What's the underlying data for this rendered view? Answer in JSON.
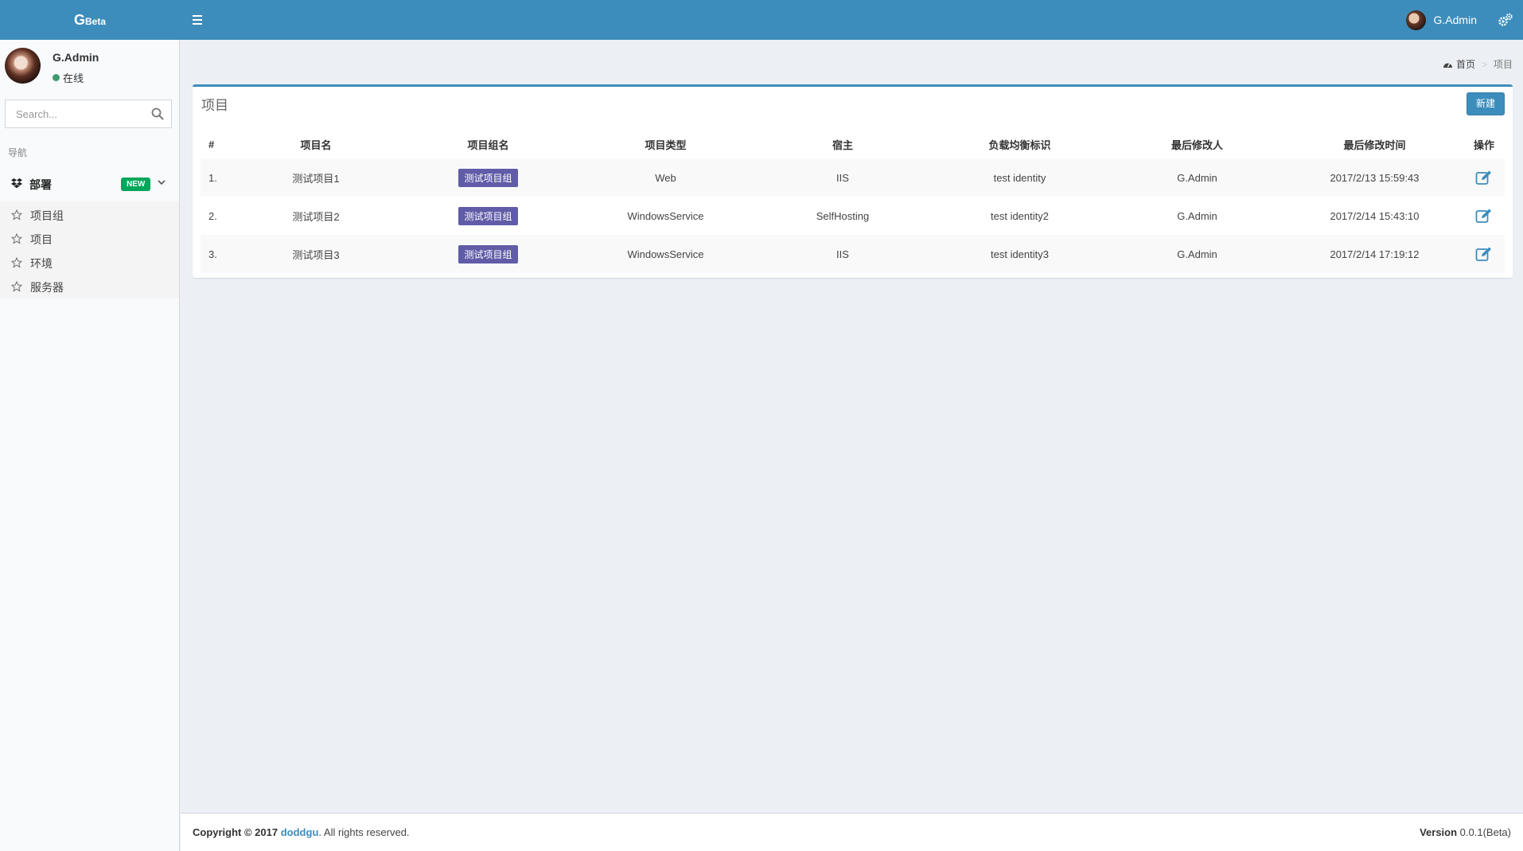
{
  "header": {
    "logo_main": "G",
    "logo_sub": "Beta",
    "user_name": "G.Admin"
  },
  "sidebar": {
    "user": {
      "name": "G.Admin",
      "status": "在线"
    },
    "search_placeholder": "Search...",
    "nav_header": "导航",
    "deploy": {
      "label": "部署",
      "badge": "NEW"
    },
    "items": [
      {
        "label": "项目组"
      },
      {
        "label": "项目"
      },
      {
        "label": "环境"
      },
      {
        "label": "服务器"
      }
    ]
  },
  "breadcrumb": {
    "home": "首页",
    "current": "项目"
  },
  "box": {
    "title": "项目",
    "new_label": "新建",
    "columns": [
      "#",
      "项目名",
      "项目组名",
      "项目类型",
      "宿主",
      "负载均衡标识",
      "最后修改人",
      "最后修改时间",
      "操作"
    ],
    "rows": [
      {
        "idx": "1.",
        "name": "测试项目1",
        "group": "测试项目组",
        "type": "Web",
        "host": "IIS",
        "lb": "test identity",
        "modifier": "G.Admin",
        "time": "2017/2/13 15:59:43"
      },
      {
        "idx": "2.",
        "name": "测试项目2",
        "group": "测试项目组",
        "type": "WindowsService",
        "host": "SelfHosting",
        "lb": "test identity2",
        "modifier": "G.Admin",
        "time": "2017/2/14 15:43:10"
      },
      {
        "idx": "3.",
        "name": "测试项目3",
        "group": "测试项目组",
        "type": "WindowsService",
        "host": "IIS",
        "lb": "test identity3",
        "modifier": "G.Admin",
        "time": "2017/2/14 17:19:12"
      }
    ]
  },
  "footer": {
    "copyright": "Copyright © 2017",
    "author": "doddgu",
    "suffix": ". All rights reserved.",
    "version_label": "Version",
    "version_value": "0.0.1(Beta)"
  },
  "colors": {
    "primary": "#3c8dbc",
    "online": "#3d9970",
    "badge_green": "#00a65a",
    "group_label": "#605ca8"
  }
}
